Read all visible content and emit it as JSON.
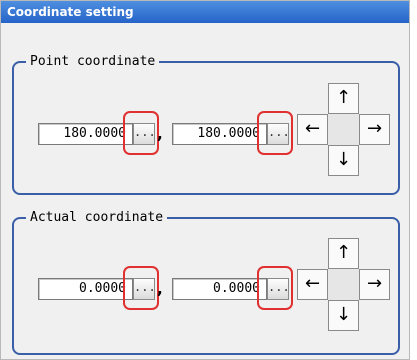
{
  "dialog": {
    "title": "Coordinate setting"
  },
  "point": {
    "label": "Point coordinate",
    "x_value": "180.0000",
    "y_value": "180.0000",
    "separator": ",",
    "browse_label": "..."
  },
  "actual": {
    "label": "Actual coordinate",
    "x_value": "0.0000",
    "y_value": "0.0000",
    "separator": ",",
    "browse_label": "..."
  },
  "arrows": {
    "up": "↑",
    "left": "←",
    "right": "→",
    "down": "↓"
  },
  "colors": {
    "title_bar": "#2563c8",
    "group_border": "#3a5fa8",
    "highlight": "#e03030"
  }
}
